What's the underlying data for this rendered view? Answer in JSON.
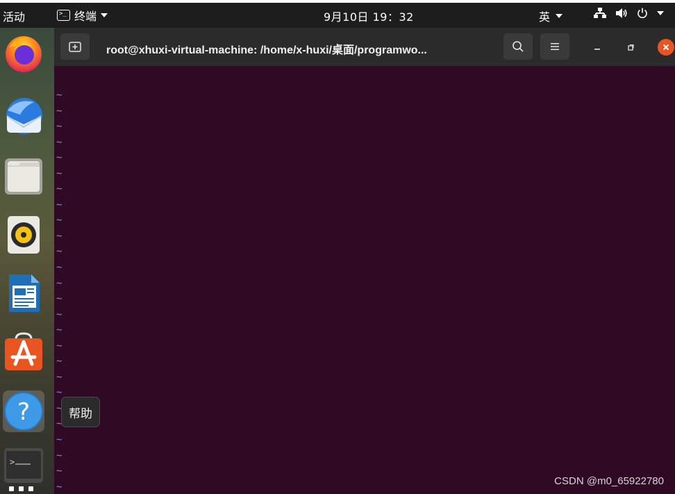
{
  "topbar": {
    "activities": "活动",
    "app_name": "终端",
    "clock": "9月10日  19：32",
    "input_method": "英"
  },
  "dock": {
    "items": [
      {
        "name": "Firefox",
        "icon": "firefox-icon"
      },
      {
        "name": "Thunderbird",
        "icon": "thunderbird-icon"
      },
      {
        "name": "Files",
        "icon": "files-icon"
      },
      {
        "name": "Rhythmbox",
        "icon": "rhythmbox-icon"
      },
      {
        "name": "LibreOffice Writer",
        "icon": "writer-icon"
      },
      {
        "name": "Ubuntu Software",
        "icon": "software-icon"
      },
      {
        "name": "Help",
        "icon": "help-icon"
      },
      {
        "name": "Terminal",
        "icon": "terminal-icon"
      }
    ],
    "help_tooltip": "帮助"
  },
  "terminal": {
    "title": "root@xhuxi-virtual-machine: /home/x-huxi/桌面/programwo...",
    "tilde": "~",
    "tilde_rows": 26
  },
  "watermark": "CSDN @m0_65922780",
  "colors": {
    "terminal_bg": "#300a24",
    "accent_close": "#e95420",
    "tilde": "#8a89c6"
  }
}
